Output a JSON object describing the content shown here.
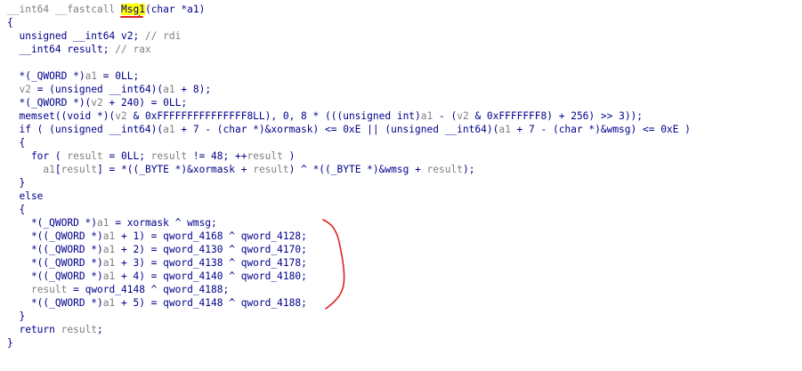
{
  "colors": {
    "keyword": "#00008b",
    "variable": "#808080",
    "highlight": "#ffff00",
    "annotation": "#e02020"
  },
  "code": {
    "lines": [
      [
        [
          "gr",
          "__int64 __fastcall "
        ],
        [
          "hl",
          "Msg"
        ],
        [
          "cursor",
          ""
        ],
        [
          "hl",
          "1"
        ],
        [
          "kw",
          "(char *a1)"
        ]
      ],
      [
        [
          "kw",
          "{"
        ]
      ],
      [
        [
          "kw",
          "  unsigned __int64 v2; "
        ],
        [
          "cm",
          "// rdi"
        ]
      ],
      [
        [
          "kw",
          "  __int64 result; "
        ],
        [
          "cm",
          "// rax"
        ]
      ],
      [],
      [
        [
          "kw",
          "  *(_QWORD *)"
        ],
        [
          "gr",
          "a1"
        ],
        [
          "kw",
          " = 0LL;"
        ]
      ],
      [
        [
          "kw",
          "  "
        ],
        [
          "gr",
          "v2"
        ],
        [
          "kw",
          " = (unsigned __int64)("
        ],
        [
          "gr",
          "a1"
        ],
        [
          "kw",
          " + 8);"
        ]
      ],
      [
        [
          "kw",
          "  *(_QWORD *)("
        ],
        [
          "gr",
          "v2"
        ],
        [
          "kw",
          " + 240) = 0LL;"
        ]
      ],
      [
        [
          "kw",
          "  memset((void *)("
        ],
        [
          "gr",
          "v2"
        ],
        [
          "kw",
          " & 0xFFFFFFFFFFFFFFF8LL), 0, 8 * (((unsigned int)"
        ],
        [
          "gr",
          "a1"
        ],
        [
          "kw",
          " - ("
        ],
        [
          "gr",
          "v2"
        ],
        [
          "kw",
          " & 0xFFFFFFF8) + 256) >> 3));"
        ]
      ],
      [
        [
          "kw",
          "  if ( (unsigned __int64)("
        ],
        [
          "gr",
          "a1"
        ],
        [
          "kw",
          " + 7 - (char *)&xormask) <= 0xE || (unsigned __int64)("
        ],
        [
          "gr",
          "a1"
        ],
        [
          "kw",
          " + 7 - (char *)&wmsg) <= 0xE )"
        ]
      ],
      [
        [
          "kw",
          "  {"
        ]
      ],
      [
        [
          "kw",
          "    for ( "
        ],
        [
          "gr",
          "result"
        ],
        [
          "kw",
          " = 0LL; "
        ],
        [
          "gr",
          "result"
        ],
        [
          "kw",
          " != 48; ++"
        ],
        [
          "gr",
          "result"
        ],
        [
          "kw",
          " )"
        ]
      ],
      [
        [
          "kw",
          "      "
        ],
        [
          "gr",
          "a1"
        ],
        [
          "kw",
          "["
        ],
        [
          "gr",
          "result"
        ],
        [
          "kw",
          "] = *((_BYTE *)&xormask + "
        ],
        [
          "gr",
          "result"
        ],
        [
          "kw",
          ") ^ *((_BYTE *)&wmsg + "
        ],
        [
          "gr",
          "result"
        ],
        [
          "kw",
          ");"
        ]
      ],
      [
        [
          "kw",
          "  }"
        ]
      ],
      [
        [
          "kw",
          "  else"
        ]
      ],
      [
        [
          "kw",
          "  {"
        ]
      ],
      [
        [
          "kw",
          "    *(_QWORD *)"
        ],
        [
          "gr",
          "a1"
        ],
        [
          "kw",
          " = xormask ^ wmsg;"
        ]
      ],
      [
        [
          "kw",
          "    *((_QWORD *)"
        ],
        [
          "gr",
          "a1"
        ],
        [
          "kw",
          " + 1) = qword_4168 ^ qword_4128;"
        ]
      ],
      [
        [
          "kw",
          "    *((_QWORD *)"
        ],
        [
          "gr",
          "a1"
        ],
        [
          "kw",
          " + 2) = qword_4130 ^ qword_4170;"
        ]
      ],
      [
        [
          "kw",
          "    *((_QWORD *)"
        ],
        [
          "gr",
          "a1"
        ],
        [
          "kw",
          " + 3) = qword_4138 ^ qword_4178;"
        ]
      ],
      [
        [
          "kw",
          "    *((_QWORD *)"
        ],
        [
          "gr",
          "a1"
        ],
        [
          "kw",
          " + 4) = qword_4140 ^ qword_4180;"
        ]
      ],
      [
        [
          "kw",
          "    "
        ],
        [
          "gr",
          "result"
        ],
        [
          "kw",
          " = qword_4148 ^ qword_4188;"
        ]
      ],
      [
        [
          "kw",
          "    *((_QWORD *)"
        ],
        [
          "gr",
          "a1"
        ],
        [
          "kw",
          " + 5) = qword_4148 ^ qword_4188;"
        ]
      ],
      [
        [
          "kw",
          "  }"
        ]
      ],
      [
        [
          "kw",
          "  return "
        ],
        [
          "gr",
          "result"
        ],
        [
          "kw",
          ";"
        ]
      ],
      [
        [
          "kw",
          "}"
        ]
      ]
    ]
  }
}
